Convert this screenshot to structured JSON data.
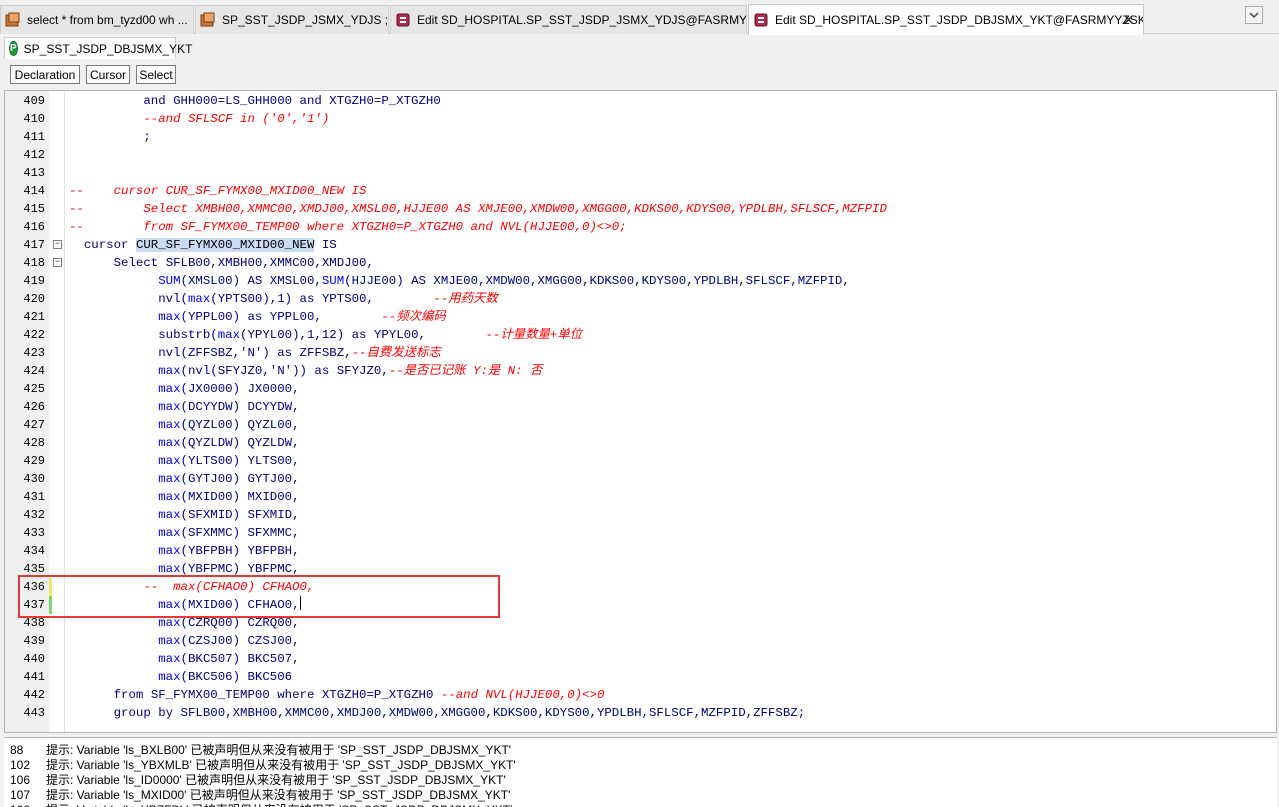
{
  "tabs": [
    {
      "label": "select * from bm_tyzd00 wh ...",
      "icon": "sql-window-icon"
    },
    {
      "label": "SP_SST_JSDP_JSMX_YDJS ; SE ...",
      "icon": "sql-window-icon"
    },
    {
      "label": "Edit SD_HOSPITAL.SP_SST_JSDP_JSMX_YDJS@FASRMYYZSK_TS",
      "icon": "program-window-icon"
    },
    {
      "label": "Edit SD_HOSPITAL.SP_SST_JSDP_DBJSMX_YKT@FASRMYYZSK_TS",
      "icon": "program-window-icon",
      "active": true
    }
  ],
  "tab_close": "✕",
  "object_tab": {
    "label": "SP_SST_JSDP_DBJSMX_YKT",
    "icon_letter": "P"
  },
  "toolbar": {
    "declaration": "Declaration",
    "cursor": "Cursor",
    "select": "Select"
  },
  "lines": [
    {
      "n": "409",
      "tokens": [
        [
          "sp",
          "          "
        ],
        [
          "kw",
          "and "
        ],
        [
          "id",
          "GHH000=LS_GHH000 "
        ],
        [
          "kw",
          "and "
        ],
        [
          "id",
          "XTGZH0=P_XTGZH0"
        ]
      ]
    },
    {
      "n": "410",
      "tokens": [
        [
          "sp",
          "          "
        ],
        [
          "cm",
          "--and SFLSCF in ('0','1')"
        ]
      ]
    },
    {
      "n": "411",
      "tokens": [
        [
          "sp",
          "          "
        ],
        [
          "id",
          ";"
        ]
      ]
    },
    {
      "n": "412",
      "tokens": []
    },
    {
      "n": "413",
      "tokens": []
    },
    {
      "n": "414",
      "tokens": [
        [
          "cm",
          "--    cursor CUR_SF_FYMX00_MXID00_NEW IS"
        ]
      ]
    },
    {
      "n": "415",
      "tokens": [
        [
          "cm",
          "--        Select XMBH00,XMMC00,XMDJ00,XMSL00,HJJE00 AS XMJE00,XMDW00,XMGG00,KDKS00,KDYS00,YPDLBH,SFLSCF,MZFPID"
        ]
      ]
    },
    {
      "n": "416",
      "tokens": [
        [
          "cm",
          "--        from SF_FYMX00_TEMP00 where XTGZH0=P_XTGZH0 and NVL(HJJE00,0)<>0;"
        ]
      ]
    },
    {
      "n": "417",
      "fold": true,
      "tokens": [
        [
          "sp",
          "  "
        ],
        [
          "kw",
          "cursor "
        ],
        [
          "hl",
          "CUR_SF_FYMX00_MXID00_NEW"
        ],
        [
          "kw",
          " IS"
        ]
      ]
    },
    {
      "n": "418",
      "fold": true,
      "tokens": [
        [
          "sp",
          "      "
        ],
        [
          "kw",
          "Select "
        ],
        [
          "id",
          "SFLB00,XMBH00,XMMC00,XMDJ00,"
        ]
      ]
    },
    {
      "n": "419",
      "tokens": [
        [
          "sp",
          "            "
        ],
        [
          "fn",
          "SUM"
        ],
        [
          "id",
          "(XMSL00) "
        ],
        [
          "kw",
          "AS "
        ],
        [
          "id",
          "XMSL00,"
        ],
        [
          "fn",
          "SUM"
        ],
        [
          "id",
          "(HJJE00) "
        ],
        [
          "kw",
          "AS "
        ],
        [
          "id",
          "XMJE00,XMDW00,XMGG00,KDKS00,KDYS00,YPDLBH,SFLSCF,MZFPID,"
        ]
      ]
    },
    {
      "n": "420",
      "tokens": [
        [
          "sp",
          "            "
        ],
        [
          "id",
          "nvl("
        ],
        [
          "fn",
          "max"
        ],
        [
          "id",
          "(YPTS00),1) "
        ],
        [
          "kw",
          "as "
        ],
        [
          "id",
          "YPTS00,        "
        ],
        [
          "cm",
          "--用药天数"
        ]
      ]
    },
    {
      "n": "421",
      "tokens": [
        [
          "sp",
          "            "
        ],
        [
          "fn",
          "max"
        ],
        [
          "id",
          "(YPPL00) "
        ],
        [
          "kw",
          "as "
        ],
        [
          "id",
          "YPPL00,        "
        ],
        [
          "cm",
          "--频次编码"
        ]
      ]
    },
    {
      "n": "422",
      "tokens": [
        [
          "sp",
          "            "
        ],
        [
          "id",
          "substrb("
        ],
        [
          "fn",
          "max"
        ],
        [
          "id",
          "(YPYL00),1,12) "
        ],
        [
          "kw",
          "as "
        ],
        [
          "id",
          "YPYL00,        "
        ],
        [
          "cm",
          "--计量数量+单位"
        ]
      ]
    },
    {
      "n": "423",
      "tokens": [
        [
          "sp",
          "            "
        ],
        [
          "id",
          "nvl(ZFFSBZ,'N') "
        ],
        [
          "kw",
          "as "
        ],
        [
          "id",
          "ZFFSBZ,"
        ],
        [
          "cm",
          "--自费发送标志"
        ]
      ]
    },
    {
      "n": "424",
      "tokens": [
        [
          "sp",
          "            "
        ],
        [
          "fn",
          "max"
        ],
        [
          "id",
          "(nvl(SFYJZ0,'N')) "
        ],
        [
          "kw",
          "as "
        ],
        [
          "id",
          "SFYJZ0,"
        ],
        [
          "cm",
          "--是否已记账 Y:是 N: 否"
        ]
      ]
    },
    {
      "n": "425",
      "tokens": [
        [
          "sp",
          "            "
        ],
        [
          "fn",
          "max"
        ],
        [
          "id",
          "(JX0000) JX0000,"
        ]
      ]
    },
    {
      "n": "426",
      "tokens": [
        [
          "sp",
          "            "
        ],
        [
          "fn",
          "max"
        ],
        [
          "id",
          "(DCYYDW) DCYYDW,"
        ]
      ]
    },
    {
      "n": "427",
      "tokens": [
        [
          "sp",
          "            "
        ],
        [
          "fn",
          "max"
        ],
        [
          "id",
          "(QYZL00) QYZL00,"
        ]
      ]
    },
    {
      "n": "428",
      "tokens": [
        [
          "sp",
          "            "
        ],
        [
          "fn",
          "max"
        ],
        [
          "id",
          "(QYZLDW) QYZLDW,"
        ]
      ]
    },
    {
      "n": "429",
      "tokens": [
        [
          "sp",
          "            "
        ],
        [
          "fn",
          "max"
        ],
        [
          "id",
          "(YLTS00) YLTS00,"
        ]
      ]
    },
    {
      "n": "430",
      "tokens": [
        [
          "sp",
          "            "
        ],
        [
          "fn",
          "max"
        ],
        [
          "id",
          "(GYTJ00) GYTJ00,"
        ]
      ]
    },
    {
      "n": "431",
      "tokens": [
        [
          "sp",
          "            "
        ],
        [
          "fn",
          "max"
        ],
        [
          "id",
          "(MXID00) MXID00,"
        ]
      ]
    },
    {
      "n": "432",
      "tokens": [
        [
          "sp",
          "            "
        ],
        [
          "fn",
          "max"
        ],
        [
          "id",
          "(SFXMID) SFXMID,"
        ]
      ]
    },
    {
      "n": "433",
      "tokens": [
        [
          "sp",
          "            "
        ],
        [
          "fn",
          "max"
        ],
        [
          "id",
          "(SFXMMC) SFXMMC,"
        ]
      ]
    },
    {
      "n": "434",
      "tokens": [
        [
          "sp",
          "            "
        ],
        [
          "fn",
          "max"
        ],
        [
          "id",
          "(YBFPBH) YBFPBH,"
        ]
      ]
    },
    {
      "n": "435",
      "tokens": [
        [
          "sp",
          "            "
        ],
        [
          "fn",
          "max"
        ],
        [
          "id",
          "(YBFPMC) YBFPMC,"
        ]
      ]
    },
    {
      "n": "436",
      "mark": "#f5e663",
      "tokens": [
        [
          "sp",
          "          "
        ],
        [
          "cm",
          "--  max(CFHAO0) CFHAO0,"
        ]
      ]
    },
    {
      "n": "437",
      "mark": "#7bd86b",
      "caret": true,
      "tokens": [
        [
          "sp",
          "            "
        ],
        [
          "fn",
          "max"
        ],
        [
          "id",
          "(MXID00) CFHAO0,"
        ]
      ]
    },
    {
      "n": "438",
      "tokens": [
        [
          "sp",
          "            "
        ],
        [
          "fn",
          "max"
        ],
        [
          "id",
          "(CZRQ00) CZRQ00,"
        ]
      ]
    },
    {
      "n": "439",
      "tokens": [
        [
          "sp",
          "            "
        ],
        [
          "fn",
          "max"
        ],
        [
          "id",
          "(CZSJ00) CZSJ00,"
        ]
      ]
    },
    {
      "n": "440",
      "tokens": [
        [
          "sp",
          "            "
        ],
        [
          "fn",
          "max"
        ],
        [
          "id",
          "(BKC507) BKC507,"
        ]
      ]
    },
    {
      "n": "441",
      "tokens": [
        [
          "sp",
          "            "
        ],
        [
          "fn",
          "max"
        ],
        [
          "id",
          "(BKC506) BKC506"
        ]
      ]
    },
    {
      "n": "442",
      "tokens": [
        [
          "sp",
          "      "
        ],
        [
          "kw",
          "from "
        ],
        [
          "id",
          "SF_FYMX00_TEMP00 "
        ],
        [
          "kw",
          "where "
        ],
        [
          "id",
          "XTGZH0=P_XTGZH0 "
        ],
        [
          "cm",
          "--and NVL(HJJE00,0)<>0"
        ]
      ]
    },
    {
      "n": "443",
      "tokens": [
        [
          "sp",
          "      "
        ],
        [
          "kw",
          "group by "
        ],
        [
          "id",
          "SFLB00,XMBH00,XMMC00,XMDJ00,XMDW00,XMGG00,KDKS00,KDYS00,YPDLBH,SFLSCF,MZFPID,ZFFSBZ;"
        ]
      ]
    }
  ],
  "messages": [
    {
      "num": "88",
      "text": "提示: Variable 'ls_BXLB00' 已被声明但从来没有被用于 'SP_SST_JSDP_DBJSMX_YKT'"
    },
    {
      "num": "102",
      "text": "提示: Variable 'ls_YBXMLB' 已被声明但从来没有被用于 'SP_SST_JSDP_DBJSMX_YKT'"
    },
    {
      "num": "106",
      "text": "提示: Variable 'ls_ID0000' 已被声明但从来没有被用于 'SP_SST_JSDP_DBJSMX_YKT'"
    },
    {
      "num": "107",
      "text": "提示: Variable 'ls_MXID00' 已被声明但从来没有被用于 'SP_SST_JSDP_DBJSMX_YKT'"
    },
    {
      "num": "108",
      "text": "提示: Variable 'ls_YBZFBL' 已被声明但从来没有被用于 'SP_SST_JSDP_DBJSMX_YKT'"
    }
  ],
  "colors": {
    "highlight_box": "#e53935",
    "comment": "#ff0000",
    "keyword": "#000080",
    "function": "#0000ff",
    "selection": "#c9dcf4"
  }
}
